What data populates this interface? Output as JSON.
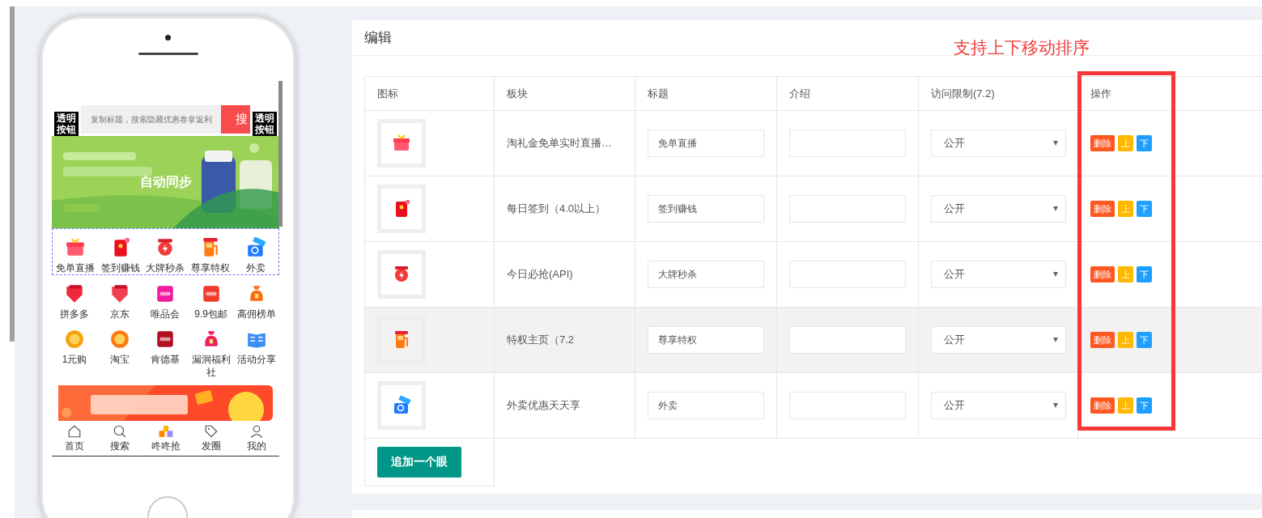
{
  "phone": {
    "search": {
      "placeholder": "复制标题，搜索隐藏优惠卷拿返利",
      "button": "搜"
    },
    "overlay_buttons": [
      "透明按钮",
      "透明按钮"
    ],
    "banner": {
      "kind": "picture",
      "label": "自动同步"
    },
    "sections": [
      {
        "selected": true,
        "items": [
          {
            "label": "免单直播"
          },
          {
            "label": "签到赚钱"
          },
          {
            "label": "大牌秒杀"
          },
          {
            "label": "尊享特权"
          },
          {
            "label": "外卖"
          }
        ]
      },
      {
        "selected": false,
        "items": [
          {
            "label": "拼多多"
          },
          {
            "label": "京东"
          },
          {
            "label": "唯品会"
          },
          {
            "label": "9.9包邮"
          },
          {
            "label": "高佣榜单"
          },
          {
            "label": "1元购"
          },
          {
            "label": "淘宝"
          },
          {
            "label": "肯德基"
          },
          {
            "label": "漏洞福利社"
          },
          {
            "label": "活动分享"
          }
        ]
      }
    ],
    "promo": {
      "kind": "picture"
    },
    "tabbar": [
      {
        "label": "首页"
      },
      {
        "label": "搜索"
      },
      {
        "label": "咚咚抢"
      },
      {
        "label": "发圈"
      },
      {
        "label": "我的"
      }
    ]
  },
  "editor": {
    "title": "编辑",
    "annotation": "支持上下移动排序",
    "columns": [
      "图标",
      "板块",
      "标题",
      "介绍",
      "访问限制(7.2)",
      "操作"
    ],
    "rows": [
      {
        "block": "淘礼金免单实时直播…",
        "title": "免单直播",
        "access": "公开",
        "hovered": false,
        "actions": [
          "删除",
          "上",
          "下"
        ]
      },
      {
        "block": "每日签到（4.0以上）",
        "title": "签到赚钱",
        "access": "公开",
        "hovered": false,
        "actions": [
          "删除",
          "上",
          "下"
        ]
      },
      {
        "block": "今日必抢(API)",
        "title": "大牌秒杀",
        "access": "公开",
        "hovered": false,
        "actions": [
          "删除",
          "上",
          "下"
        ]
      },
      {
        "block": "特权主页（7.2",
        "title": "尊享特权",
        "access": "公开",
        "hovered": true,
        "actions": [
          "删除",
          "上",
          "下"
        ]
      },
      {
        "block": "外卖优惠天天享",
        "title": "外卖",
        "access": "公开",
        "hovered": false,
        "actions": [
          "删除",
          "上",
          "下"
        ]
      }
    ],
    "add_button": "追加一个眼"
  }
}
